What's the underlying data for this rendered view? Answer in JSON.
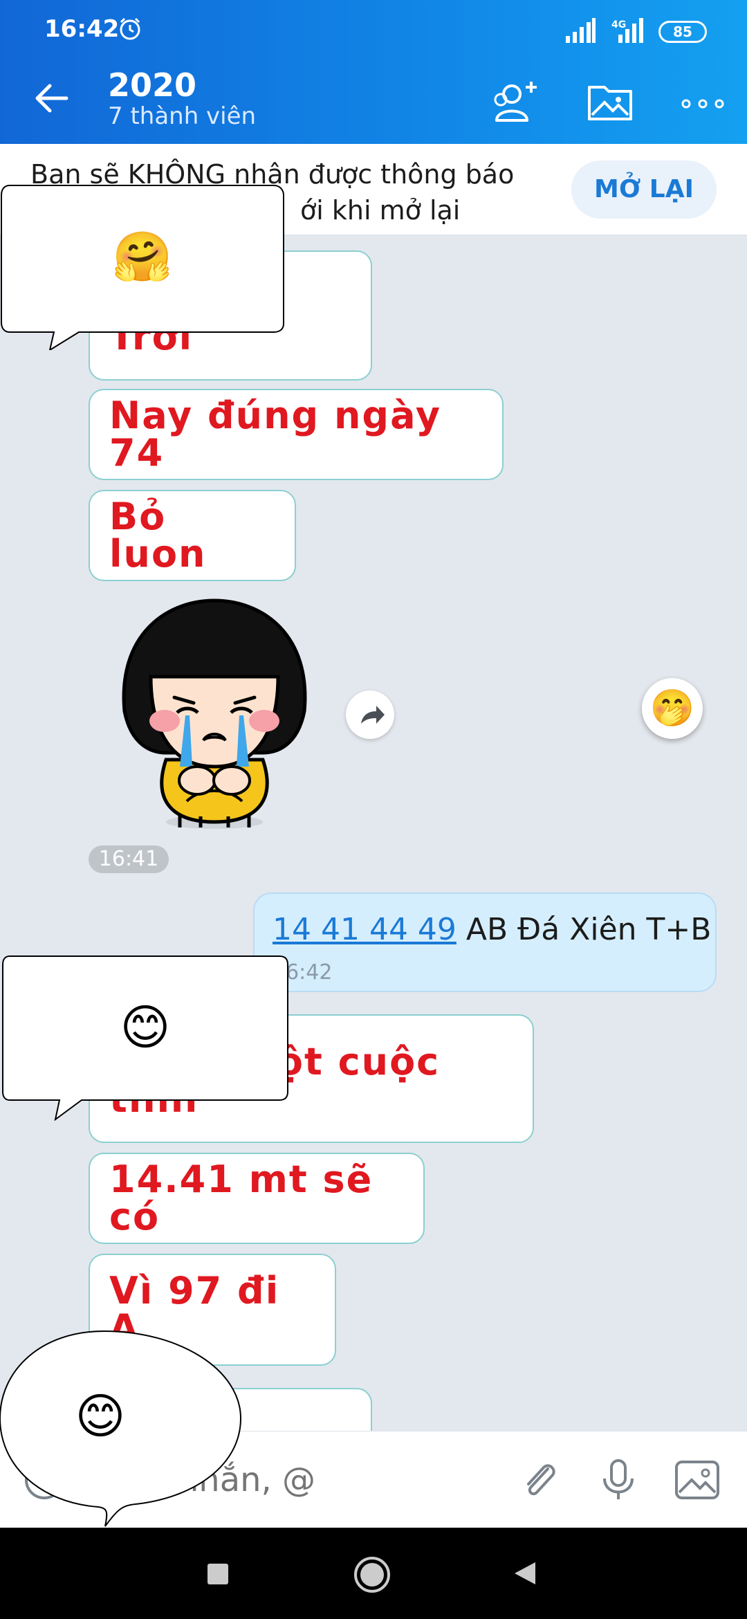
{
  "status_bar": {
    "time": "16:42",
    "network": "4G",
    "battery": "85"
  },
  "header": {
    "title": "2020",
    "subtitle": "7 thành viên",
    "icons": [
      "back-arrow-icon",
      "add-member-icon",
      "media-folder-icon",
      "more-options-icon"
    ]
  },
  "banner": {
    "line1": "Bạn sẽ KHÔNG nhận được thông báo",
    "line2": "ới khi mở lại",
    "button": "MỞ LẠI"
  },
  "messages": [
    {
      "text": "Trời",
      "from": "other"
    },
    {
      "text": "Nay đúng ngày 74",
      "from": "other"
    },
    {
      "text": "Bỏ luon",
      "from": "other"
    },
    {
      "sticker": "crying-girl-sticker",
      "from": "other"
    },
    {
      "time": "16:41"
    },
    {
      "link": "14 41 44 49",
      "text": " AB Đá Xiên T+B",
      "time": "16:42",
      "from": "me"
    },
    {
      "text": "Xong một cuộc tình",
      "from": "other"
    },
    {
      "text": "14.41 mt sẽ có",
      "from": "other"
    },
    {
      "text": "Vì 97 đi A",
      "from": "other"
    }
  ],
  "overlays": [
    {
      "emoji": "🤗"
    },
    {
      "emoji": "😊"
    },
    {
      "emoji": "😊"
    }
  ],
  "reaction": "🤭",
  "input": {
    "placeholder": "Tin nhắn, @"
  },
  "colors": {
    "header_gradient_start": "#1167d6",
    "header_gradient_end": "#14a0f0",
    "message_text": "#e01820",
    "bubble_border": "#8bcfd1",
    "outgoing_bg": "#d5eefd",
    "chat_bg": "#e3e8ee",
    "link": "#1a7ad6"
  }
}
